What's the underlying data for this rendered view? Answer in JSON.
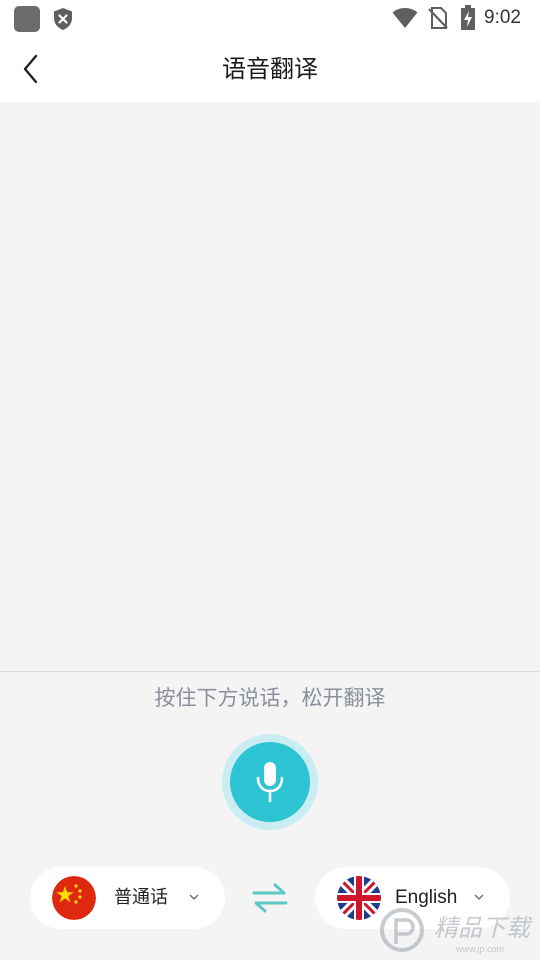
{
  "status_bar": {
    "time": "9:02",
    "icons": [
      "app-icon",
      "shield-icon",
      "wifi-icon",
      "no-sim-icon",
      "battery-charging-icon"
    ]
  },
  "header": {
    "title": "语音翻译",
    "back_icon": "chevron-left-icon"
  },
  "voice": {
    "hint": "按住下方说话，松开翻译",
    "mic_icon": "microphone-icon",
    "accent_color": "#2cc3d2"
  },
  "languages": {
    "source": {
      "label": "普通话",
      "flag": "china-flag-icon"
    },
    "target": {
      "label": "English",
      "flag": "uk-flag-icon"
    },
    "swap_icon": "swap-arrows-icon"
  },
  "watermark": {
    "text": "精品下载",
    "subtext": "www.jp.com"
  }
}
